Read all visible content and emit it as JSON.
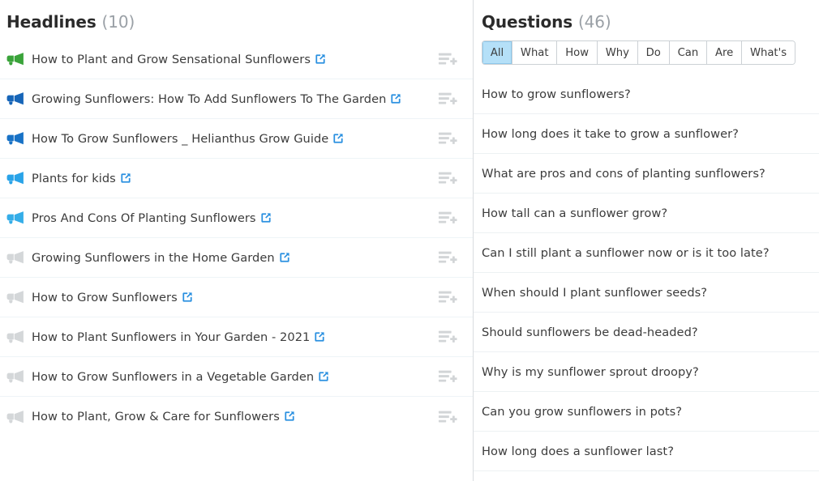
{
  "headlines_panel": {
    "title": "Headlines",
    "count": "(10)",
    "items": [
      {
        "text": "How to Plant and Grow Sensational Sunflowers",
        "icon": "megaphone-icon",
        "icon_color": "#3aa33a",
        "link_icon": "external-link-icon",
        "add_icon": "add-to-list-icon"
      },
      {
        "text": "Growing Sunflowers: How To Add Sunflowers To The Garden",
        "icon": "megaphone-icon",
        "icon_color": "#1665b8",
        "link_icon": "external-link-icon",
        "add_icon": "add-to-list-icon"
      },
      {
        "text": "How To Grow Sunflowers _ Helianthus Grow Guide",
        "icon": "megaphone-icon",
        "icon_color": "#1872c6",
        "link_icon": "external-link-icon",
        "add_icon": "add-to-list-icon"
      },
      {
        "text": "Plants for kids",
        "icon": "megaphone-icon",
        "icon_color": "#29a3e8",
        "link_icon": "external-link-icon",
        "add_icon": "add-to-list-icon"
      },
      {
        "text": "Pros And Cons Of Planting Sunflowers",
        "icon": "megaphone-icon",
        "icon_color": "#34ade8",
        "link_icon": "external-link-icon",
        "add_icon": "add-to-list-icon"
      },
      {
        "text": "Growing Sunflowers in the Home Garden",
        "icon": "megaphone-icon",
        "icon_color": "#d4d7d9",
        "link_icon": "external-link-icon",
        "add_icon": "add-to-list-icon"
      },
      {
        "text": "How to Grow Sunflowers",
        "icon": "megaphone-icon",
        "icon_color": "#d4d7d9",
        "link_icon": "external-link-icon",
        "add_icon": "add-to-list-icon"
      },
      {
        "text": "How to Plant Sunflowers in Your Garden - 2021",
        "icon": "megaphone-icon",
        "icon_color": "#d4d7d9",
        "link_icon": "external-link-icon",
        "add_icon": "add-to-list-icon"
      },
      {
        "text": "How to Grow Sunflowers in a Vegetable Garden",
        "icon": "megaphone-icon",
        "icon_color": "#d4d7d9",
        "link_icon": "external-link-icon",
        "add_icon": "add-to-list-icon"
      },
      {
        "text": "How to Plant, Grow & Care for Sunflowers",
        "icon": "megaphone-icon",
        "icon_color": "#d4d7d9",
        "link_icon": "external-link-icon",
        "add_icon": "add-to-list-icon"
      }
    ]
  },
  "questions_panel": {
    "title": "Questions",
    "count": "(46)",
    "tabs": [
      {
        "label": "All",
        "active": true
      },
      {
        "label": "What",
        "active": false
      },
      {
        "label": "How",
        "active": false
      },
      {
        "label": "Why",
        "active": false
      },
      {
        "label": "Do",
        "active": false
      },
      {
        "label": "Can",
        "active": false
      },
      {
        "label": "Are",
        "active": false
      },
      {
        "label": "What's",
        "active": false
      }
    ],
    "items": [
      {
        "text": "How to grow sunflowers?"
      },
      {
        "text": "How long does it take to grow a sunflower?"
      },
      {
        "text": "What are pros and cons of planting sunflowers?"
      },
      {
        "text": "How tall can a sunflower grow?"
      },
      {
        "text": "Can I still plant a sunflower now or is it too late?"
      },
      {
        "text": "When should I plant sunflower seeds?"
      },
      {
        "text": "Should sunflowers be dead-headed?"
      },
      {
        "text": "Why is my sunflower sprout droopy?"
      },
      {
        "text": "Can you grow sunflowers in pots?"
      },
      {
        "text": "How long does a sunflower last?"
      }
    ]
  },
  "colors": {
    "accent_blue": "#2a90e0",
    "active_tab_bg": "#b5e0f8",
    "active_tab_border": "#8ec9ec",
    "text": "#3c3c3c",
    "muted": "#9aa0a6",
    "row_divider": "#eef4f7",
    "panel_divider": "#d9dde0",
    "add_icon_gray": "#d2d5d7"
  }
}
